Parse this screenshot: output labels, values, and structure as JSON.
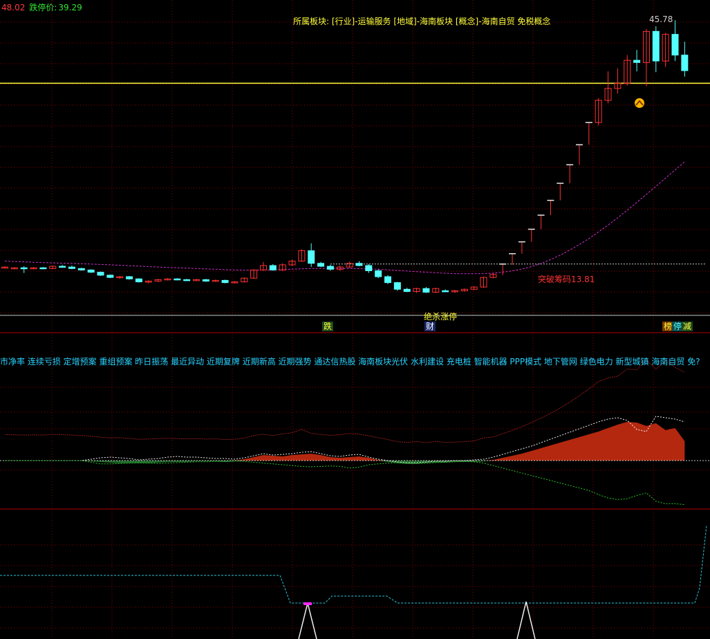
{
  "header": {
    "limit_up_value": "48.02",
    "limit_down_label": "跌停价:",
    "limit_down_value": "39.29"
  },
  "sector_info": "所属板块: [行业]-运输服务 [地域]-海南板块 [概念]-海南自贸 免税概念",
  "concept_bar": "市净率 连续亏损 定增预案 重组预案 昨日振荡 最近异动 近期复牌 近期新高 近期强势 通达信热股 海南板块光伏 水利建设 充电桩 智能机器 PPP模式 地下管网 绿色电力 新型城镇 海南自贸 免?",
  "annotations": {
    "breakout_label": "突破筹码13.81",
    "high_label": "45.78",
    "limit_up_streak_label": "绝杀涨停"
  },
  "tags": {
    "drop": "跌",
    "finance": "财",
    "rank": "榜",
    "halt": "停",
    "reduce": "减"
  },
  "colors": {
    "up": "#ff3232",
    "down": "#54ffff",
    "grid": "#8b0000",
    "highline": "#ffff3c",
    "ma": "#c832c8",
    "money_up": "#b4280f",
    "money_down": "#1e6428"
  },
  "chart_data": [
    {
      "type": "candlestick",
      "ylim": [
        8,
        48.5
      ],
      "high_line": 38.2,
      "breakout_line": 13.81,
      "ohlc": [
        [
          13.3,
          13.5,
          13.2,
          13.4
        ],
        [
          13.3,
          13.4,
          13.1,
          13.3
        ],
        [
          13.3,
          13.5,
          12.6,
          13.2
        ],
        [
          13.2,
          13.4,
          13.1,
          13.3
        ],
        [
          13.3,
          13.4,
          13.1,
          13.2
        ],
        [
          13.2,
          13.6,
          13.1,
          13.5
        ],
        [
          13.5,
          13.7,
          13.3,
          13.4
        ],
        [
          13.4,
          13.6,
          13.1,
          13.2
        ],
        [
          13.2,
          13.3,
          12.9,
          13.0
        ],
        [
          13.0,
          13.1,
          12.6,
          12.7
        ],
        [
          12.7,
          12.8,
          12.2,
          12.3
        ],
        [
          12.3,
          12.4,
          11.9,
          12.0
        ],
        [
          12.0,
          12.2,
          11.8,
          12.1
        ],
        [
          12.1,
          12.2,
          11.7,
          11.8
        ],
        [
          11.8,
          11.9,
          11.3,
          11.4
        ],
        [
          11.4,
          11.6,
          11.2,
          11.5
        ],
        [
          11.5,
          11.8,
          11.4,
          11.7
        ],
        [
          11.7,
          11.9,
          11.6,
          11.8
        ],
        [
          11.8,
          11.9,
          11.6,
          11.7
        ],
        [
          11.7,
          11.8,
          11.5,
          11.6
        ],
        [
          11.6,
          11.8,
          11.5,
          11.7
        ],
        [
          11.7,
          11.8,
          11.4,
          11.5
        ],
        [
          11.5,
          11.7,
          11.4,
          11.6
        ],
        [
          11.6,
          11.7,
          11.2,
          11.3
        ],
        [
          11.3,
          11.5,
          11.2,
          11.4
        ],
        [
          11.4,
          12.0,
          11.3,
          11.9
        ],
        [
          11.9,
          13.1,
          11.8,
          13.0
        ],
        [
          13.0,
          14.1,
          12.9,
          13.6
        ],
        [
          13.6,
          13.8,
          12.9,
          13.0
        ],
        [
          13.0,
          13.9,
          12.9,
          13.7
        ],
        [
          13.7,
          14.4,
          13.5,
          14.2
        ],
        [
          14.2,
          15.8,
          14.1,
          15.6
        ],
        [
          15.6,
          16.6,
          13.4,
          13.9
        ],
        [
          13.9,
          14.1,
          13.4,
          13.5
        ],
        [
          13.5,
          13.7,
          12.9,
          13.1
        ],
        [
          13.1,
          13.6,
          12.9,
          13.4
        ],
        [
          13.4,
          14.1,
          13.3,
          13.9
        ],
        [
          13.9,
          14.2,
          13.5,
          13.6
        ],
        [
          13.6,
          13.8,
          12.6,
          12.9
        ],
        [
          12.9,
          13.1,
          11.9,
          12.1
        ],
        [
          12.1,
          12.3,
          11.1,
          11.3
        ],
        [
          11.3,
          11.4,
          10.2,
          10.4
        ],
        [
          10.4,
          10.6,
          10.0,
          10.1
        ],
        [
          10.1,
          10.6,
          9.9,
          10.5
        ],
        [
          10.5,
          10.7,
          9.9,
          10.0
        ],
        [
          10.0,
          10.6,
          9.9,
          10.5
        ],
        [
          10.2,
          10.4,
          10.0,
          10.1
        ],
        [
          10.1,
          10.3,
          9.9,
          10.2
        ],
        [
          10.2,
          10.5,
          10.1,
          10.4
        ],
        [
          10.4,
          10.8,
          10.3,
          10.7
        ],
        [
          10.7,
          12.1,
          10.6,
          12.0
        ],
        [
          12.0,
          12.6,
          11.9,
          12.4
        ],
        [
          12.4,
          13.9,
          12.3,
          13.8
        ],
        [
          13.8,
          15.2,
          13.7,
          15.2
        ],
        [
          15.2,
          16.8,
          15.2,
          16.8
        ],
        [
          16.8,
          18.5,
          16.8,
          18.5
        ],
        [
          18.5,
          20.4,
          18.5,
          20.4
        ],
        [
          20.4,
          22.4,
          20.4,
          22.4
        ],
        [
          22.4,
          24.7,
          22.4,
          24.7
        ],
        [
          24.7,
          27.2,
          24.7,
          27.2
        ],
        [
          27.2,
          29.9,
          27.2,
          29.9
        ],
        [
          29.9,
          32.9,
          29.9,
          32.9
        ],
        [
          32.9,
          36.2,
          32.5,
          35.9
        ],
        [
          35.9,
          39.8,
          35.5,
          37.5
        ],
        [
          37.5,
          40.2,
          36.8,
          38.2
        ],
        [
          38.2,
          42.0,
          37.9,
          41.3
        ],
        [
          41.3,
          42.7,
          39.8,
          41.0
        ],
        [
          41.0,
          45.5,
          37.8,
          45.2
        ],
        [
          45.2,
          45.9,
          39.7,
          41.2
        ],
        [
          41.2,
          45.0,
          40.4,
          44.8
        ],
        [
          44.8,
          46.7,
          41.2,
          42.0
        ],
        [
          42.0,
          43.8,
          39.1,
          39.9
        ]
      ],
      "ma": [
        14.2,
        14.15,
        14.1,
        14.05,
        14.0,
        13.96,
        13.92,
        13.88,
        13.84,
        13.8,
        13.75,
        13.7,
        13.64,
        13.58,
        13.52,
        13.46,
        13.4,
        13.35,
        13.3,
        13.25,
        13.2,
        13.15,
        13.1,
        13.05,
        13.0,
        12.98,
        12.98,
        13.0,
        13.02,
        13.05,
        13.1,
        13.16,
        13.2,
        13.22,
        13.22,
        13.21,
        13.2,
        13.18,
        13.15,
        13.1,
        13.02,
        12.94,
        12.86,
        12.78,
        12.7,
        12.62,
        12.56,
        12.52,
        12.5,
        12.5,
        12.52,
        12.58,
        12.7,
        12.88,
        13.12,
        13.45,
        13.88,
        14.4,
        15.0,
        15.68,
        16.43,
        17.25,
        18.13,
        19.06,
        20.04,
        21.06,
        22.12,
        23.2,
        24.3,
        25.4,
        26.5,
        27.6
      ]
    },
    {
      "type": "area",
      "ylim": [
        -1,
        1
      ],
      "values": [
        0.0,
        0.0,
        0.0,
        0.0,
        0.0,
        0.0,
        0.0,
        0.0,
        0.0,
        -0.01,
        -0.02,
        -0.03,
        -0.04,
        -0.04,
        -0.04,
        -0.04,
        -0.03,
        -0.02,
        -0.02,
        -0.02,
        -0.01,
        -0.01,
        -0.01,
        -0.02,
        -0.01,
        0.02,
        0.05,
        0.08,
        0.07,
        0.06,
        0.08,
        0.09,
        0.1,
        0.08,
        0.05,
        0.04,
        0.05,
        0.06,
        0.04,
        0.01,
        -0.02,
        -0.04,
        -0.05,
        -0.05,
        -0.04,
        -0.03,
        -0.03,
        -0.02,
        -0.02,
        -0.02,
        -0.01,
        0.01,
        0.04,
        0.07,
        0.1,
        0.14,
        0.18,
        0.22,
        0.26,
        0.3,
        0.34,
        0.38,
        0.42,
        0.47,
        0.52,
        0.56,
        0.55,
        0.5,
        0.54,
        0.44,
        0.47,
        0.28
      ],
      "upper": [
        0.0,
        0.0,
        0.0,
        0.0,
        0.0,
        0.0,
        0.0,
        0.0,
        0.0,
        0.02,
        0.04,
        0.05,
        0.04,
        0.03,
        0.01,
        0.02,
        0.03,
        0.05,
        0.06,
        0.05,
        0.05,
        0.04,
        0.03,
        0.03,
        0.02,
        0.04,
        0.07,
        0.1,
        0.08,
        0.09,
        0.1,
        0.12,
        0.13,
        0.1,
        0.07,
        0.06,
        0.08,
        0.09,
        0.05,
        0.02,
        0.0,
        -0.02,
        -0.03,
        -0.03,
        -0.02,
        -0.01,
        -0.01,
        0.0,
        0.0,
        0.01,
        0.02,
        0.05,
        0.09,
        0.13,
        0.17,
        0.21,
        0.26,
        0.31,
        0.36,
        0.41,
        0.46,
        0.51,
        0.56,
        0.6,
        0.62,
        0.58,
        0.45,
        0.42,
        0.64,
        0.62,
        0.6,
        0.56
      ],
      "lower": [
        0.0,
        0.0,
        0.0,
        0.0,
        0.0,
        0.0,
        0.0,
        0.0,
        0.0,
        -0.04,
        -0.08,
        -0.08,
        -0.07,
        -0.06,
        -0.05,
        -0.06,
        -0.07,
        -0.06,
        -0.05,
        -0.04,
        -0.03,
        -0.03,
        -0.02,
        -0.02,
        -0.01,
        -0.02,
        -0.04,
        -0.06,
        -0.08,
        -0.1,
        -0.12,
        -0.14,
        -0.15,
        -0.14,
        -0.13,
        -0.14,
        -0.18,
        -0.16,
        -0.1,
        -0.08,
        -0.06,
        -0.05,
        -0.06,
        -0.07,
        -0.06,
        -0.05,
        -0.04,
        -0.03,
        -0.02,
        -0.03,
        -0.06,
        -0.12,
        -0.18,
        -0.24,
        -0.3,
        -0.36,
        -0.42,
        -0.48,
        -0.54,
        -0.6,
        -0.66,
        -0.72,
        -0.82,
        -0.9,
        -0.94,
        -0.92,
        -0.84,
        -0.78,
        -0.98,
        -1.04,
        -1.04,
        -1.06
      ]
    },
    {
      "type": "line",
      "ylim": [
        0,
        100
      ],
      "values": [
        44,
        44,
        44,
        44,
        44,
        44,
        44,
        44,
        44,
        44,
        44,
        44,
        44,
        44,
        44,
        44,
        44,
        44,
        44,
        44,
        44,
        44,
        44,
        44,
        44,
        44,
        44,
        44,
        44,
        44,
        44,
        44,
        44,
        44,
        44,
        44,
        44,
        44,
        44,
        44,
        44,
        44,
        44,
        44,
        44,
        44,
        44,
        44,
        44,
        44,
        44,
        44,
        44,
        44,
        44,
        44,
        44,
        44,
        44,
        44,
        44,
        44,
        44,
        44,
        44,
        44,
        44,
        44,
        44,
        44,
        44,
        44
      ]
    }
  ]
}
